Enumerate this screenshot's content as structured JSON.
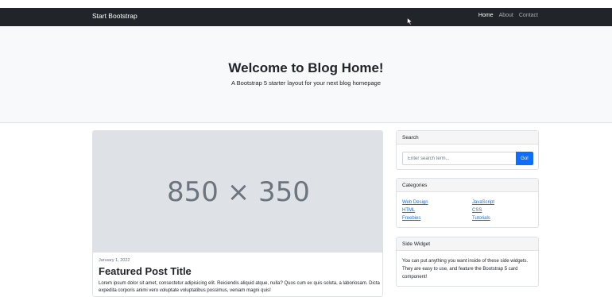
{
  "navbar": {
    "brand": "Start Bootstrap",
    "links": [
      {
        "label": "Home",
        "active": true
      },
      {
        "label": "About",
        "active": false
      },
      {
        "label": "Contact",
        "active": false
      }
    ]
  },
  "hero": {
    "title": "Welcome to Blog Home!",
    "lead": "A Bootstrap 5 starter layout for your next blog homepage"
  },
  "featured_post": {
    "image_placeholder": "850 × 350",
    "date": "January 1, 2022",
    "title": "Featured Post Title",
    "excerpt": "Lorem ipsum dolor sit amet, consectetur adipisicing elit. Reiciendis aliquid atque, nulla? Quos cum ex quis soluta, a laboriosam. Dicta expedita corporis animi vero voluptate voluptatibus possimus, veniam magni quis!"
  },
  "search": {
    "header": "Search",
    "placeholder": "Enter search term...",
    "value": "",
    "button": "Go!"
  },
  "categories": {
    "header": "Categories",
    "left": [
      "Web Design",
      "HTML",
      "Freebies"
    ],
    "right": [
      "JavaScript",
      "CSS",
      "Tutorials"
    ]
  },
  "side_widget": {
    "header": "Side Widget",
    "text": "You can put anything you want inside of these side widgets. They are easy to use, and feature the Bootstrap 5 card component!"
  },
  "colors": {
    "navbar_bg": "#212529",
    "accent": "#0d6efd",
    "hero_bg": "#f8f9fa",
    "placeholder_bg": "#dee2e6"
  },
  "icons": [
    "mouse-cursor-icon"
  ]
}
